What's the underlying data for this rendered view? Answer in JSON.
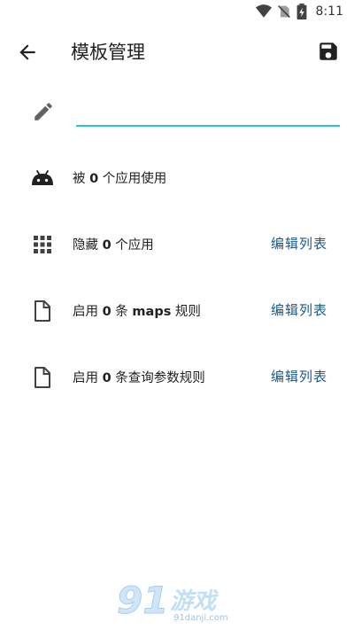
{
  "status": {
    "time": "8:11"
  },
  "appbar": {
    "title": "模板管理"
  },
  "name_field": {
    "value": "",
    "placeholder": ""
  },
  "rows": [
    {
      "id": "used-by",
      "pre": "被 ",
      "count": "0",
      "post": " 个应用使用",
      "action": ""
    },
    {
      "id": "hide-apps",
      "pre": "隐藏 ",
      "count": "0",
      "post": " 个应用",
      "action": "编辑列表"
    },
    {
      "id": "maps-rules",
      "pre": "启用 ",
      "count": "0",
      "mid": " 条 ",
      "bold2": "maps",
      "post": " 规则",
      "action": "编辑列表"
    },
    {
      "id": "query-rules",
      "pre": "启用 ",
      "count": "0",
      "post": " 条查询参数规则",
      "action": "编辑列表"
    }
  ],
  "watermark": {
    "text": "游戏",
    "site": "91danji.com"
  },
  "colors": {
    "accent": "#26c6c6",
    "action": "#1b5a8a",
    "icon": "#424242"
  }
}
